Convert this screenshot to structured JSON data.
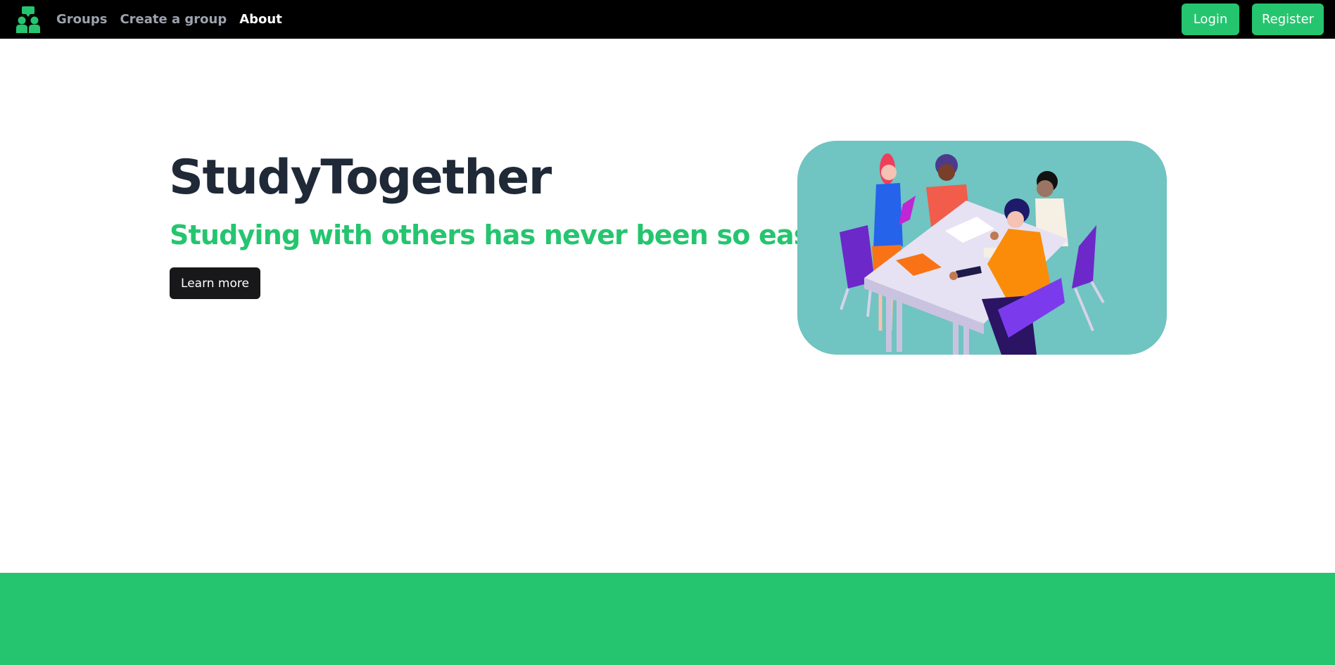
{
  "app": {
    "logo_icon": "people-chat-logo-icon"
  },
  "nav": {
    "links": [
      {
        "label": "Groups",
        "active": false
      },
      {
        "label": "Create a group",
        "active": false
      },
      {
        "label": "About",
        "active": true
      }
    ],
    "login_label": "Login",
    "register_label": "Register"
  },
  "hero": {
    "title": "StudyTogether",
    "subtitle": "Studying with others has never been so easy!",
    "cta_label": "Learn more",
    "illustration": "group-study-table-illustration"
  },
  "colors": {
    "navbar": "#000000",
    "accent": "#25c56f",
    "title": "#1f2937",
    "cta_background": "#18181b",
    "illustration_background": "#70c4c1",
    "nav_link_inactive": "#9ca3af",
    "nav_link_active": "#ffffff"
  }
}
